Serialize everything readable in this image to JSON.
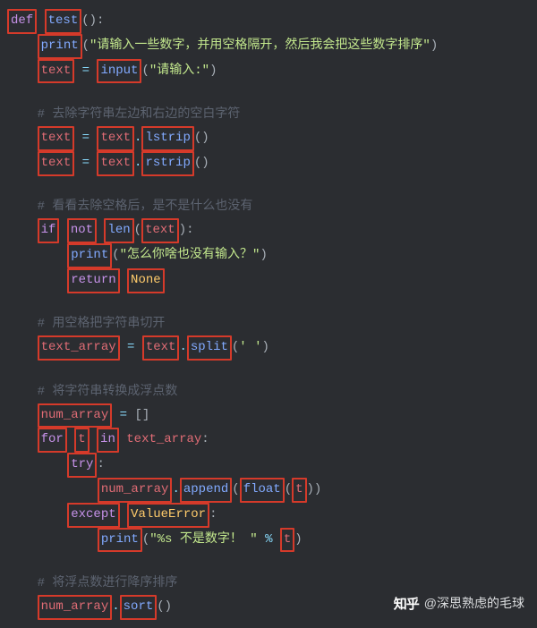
{
  "code": {
    "def": "def",
    "test": "test",
    "print": "print",
    "s_prompt1": "\"请输入一些数字，并用空格隔开，然后我会把这些数字排序\"",
    "text": "text",
    "input": "input",
    "s_prompt2": "\"请输入:\"",
    "cmt_strip": "# 去除字符串左边和右边的空白字符",
    "lstrip": "lstrip",
    "rstrip": "rstrip",
    "cmt_check": "# 看看去除空格后，是不是什么也没有",
    "if": "if",
    "not": "not",
    "len": "len",
    "s_empty": "\"怎么你啥也没有输入？\"",
    "return": "return",
    "none": "None",
    "cmt_split": "# 用空格把字符串切开",
    "text_array": "text_array",
    "split": "split",
    "s_space": "' '",
    "cmt_float": "# 将字符串转换成浮点数",
    "num_array": "num_array",
    "for": "for",
    "t": "t",
    "in": "in",
    "try": "try",
    "append": "append",
    "float": "float",
    "except": "except",
    "valueerror": "ValueError",
    "s_notnum": "\"%s 不是数字！ \"",
    "pct": "%",
    "cmt_sort": "# 将浮点数进行降序排序",
    "sort": "sort"
  },
  "watermark": {
    "brand": "知乎",
    "author": "@深思熟虑的毛球"
  }
}
